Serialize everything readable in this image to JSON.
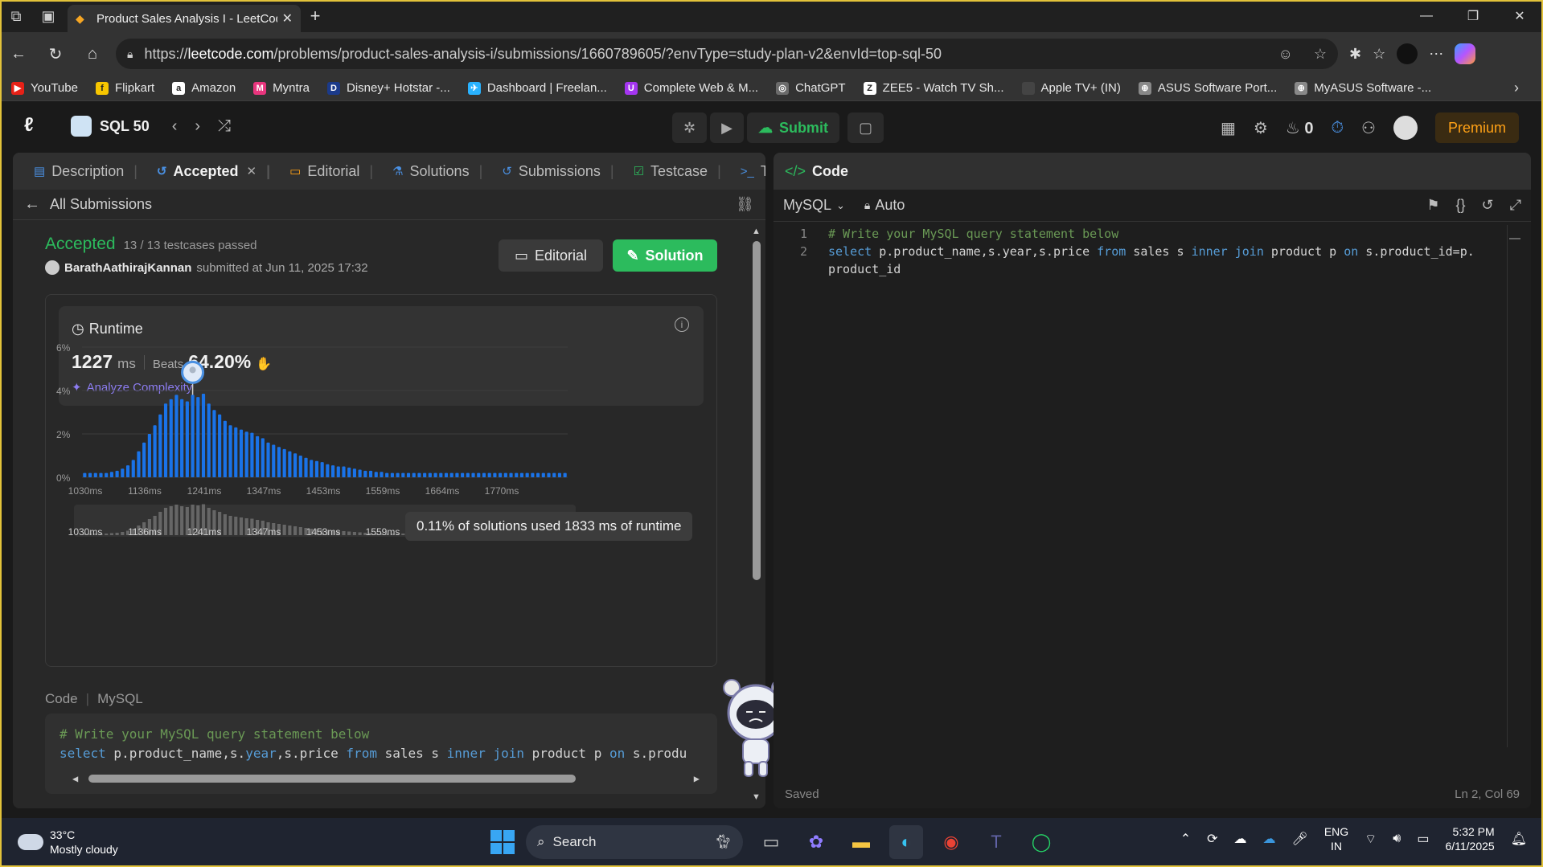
{
  "browser": {
    "tab_title": "Product Sales Analysis I - LeetCod",
    "url_prefix": "https://",
    "url_host": "leetcode.com",
    "url_path": "/problems/product-sales-analysis-i/submissions/1660789605/?envType=study-plan-v2&envId=top-sql-50",
    "bookmarks": [
      {
        "label": "YouTube",
        "color": "#e62117",
        "glyph": "▶"
      },
      {
        "label": "Flipkart",
        "color": "#f7c600",
        "glyph": "f"
      },
      {
        "label": "Amazon",
        "color": "#ffffff",
        "glyph": "a"
      },
      {
        "label": "Myntra",
        "color": "#e8357d",
        "glyph": "M"
      },
      {
        "label": "Disney+ Hotstar -...",
        "color": "#1b3a8a",
        "glyph": "D"
      },
      {
        "label": "Dashboard | Freelan...",
        "color": "#29b2fe",
        "glyph": "✈"
      },
      {
        "label": "Complete Web & M...",
        "color": "#a435f0",
        "glyph": "U"
      },
      {
        "label": "ChatGPT",
        "color": "#6b6b6b",
        "glyph": "◎"
      },
      {
        "label": "ZEE5 - Watch TV Sh...",
        "color": "#ffffff",
        "glyph": "Z"
      },
      {
        "label": "Apple TV+ (IN)",
        "color": "#444444",
        "glyph": ""
      },
      {
        "label": "ASUS Software Port...",
        "color": "#888888",
        "glyph": "⊕"
      },
      {
        "label": "MyASUS Software -...",
        "color": "#888888",
        "glyph": "⊕"
      }
    ]
  },
  "lcnav": {
    "study_plan": "SQL 50",
    "submit_label": "Submit",
    "streak_count": "0",
    "premium_label": "Premium"
  },
  "left": {
    "tabs": [
      {
        "label": "Description",
        "icon": "description-icon",
        "glyph": "▤"
      },
      {
        "label": "Accepted",
        "icon": "history-icon",
        "glyph": "↺"
      },
      {
        "label": "Editorial",
        "icon": "book-icon",
        "glyph": "▭"
      },
      {
        "label": "Solutions",
        "icon": "flask-icon",
        "glyph": "⚗"
      },
      {
        "label": "Submissions",
        "icon": "history-icon",
        "glyph": "↺"
      },
      {
        "label": "Testcase",
        "icon": "checkbox-icon",
        "glyph": "☑"
      },
      {
        "label": "Test Result",
        "icon": "terminal-icon",
        "glyph": ">_"
      }
    ],
    "all_submissions": "All Submissions",
    "status": "Accepted",
    "testcases": "13 / 13 testcases passed",
    "username": "BarathAathirajKannan",
    "submitted_at": "submitted at Jun 11, 2025 17:32",
    "editorial_btn": "Editorial",
    "solution_btn": "Solution",
    "runtime_label": "Runtime",
    "runtime_value": "1227",
    "runtime_unit": "ms",
    "beats_label": "Beats",
    "beats_value": "64.20%",
    "analyze_label": "Analyze Complexity",
    "tooltip": "0.11% of solutions used 1833 ms of runtime",
    "code_label": "Code",
    "code_lang": "MySQL",
    "code_comment": "# Write your MySQL query statement below",
    "code_tokens": [
      {
        "t": "select",
        "k": "kw"
      },
      {
        "t": " p.product_name,s.",
        "k": "txt"
      },
      {
        "t": "year",
        "k": "kw"
      },
      {
        "t": ",s.price ",
        "k": "txt"
      },
      {
        "t": "from",
        "k": "kw"
      },
      {
        "t": " sales s ",
        "k": "txt"
      },
      {
        "t": "inner",
        "k": "kw"
      },
      {
        "t": " ",
        "k": "txt"
      },
      {
        "t": "join",
        "k": "kw"
      },
      {
        "t": " product p ",
        "k": "txt"
      },
      {
        "t": "on",
        "k": "kw"
      },
      {
        "t": " s.produ",
        "k": "txt"
      }
    ]
  },
  "chart_data": {
    "type": "bar",
    "ylabel": "",
    "xlabel": "",
    "yticks": [
      "0%",
      "2%",
      "4%",
      "6%"
    ],
    "ylim": [
      0,
      6
    ],
    "xticks": [
      "1030ms",
      "1136ms",
      "1241ms",
      "1347ms",
      "1453ms",
      "1559ms",
      "1664ms",
      "1770ms"
    ],
    "highlight_index": 20,
    "values": [
      0.2,
      0.2,
      0.2,
      0.2,
      0.2,
      0.25,
      0.3,
      0.4,
      0.55,
      0.8,
      1.2,
      1.6,
      2.0,
      2.4,
      2.9,
      3.4,
      3.6,
      3.8,
      3.6,
      3.5,
      3.8,
      3.7,
      3.85,
      3.4,
      3.1,
      2.9,
      2.6,
      2.4,
      2.3,
      2.2,
      2.1,
      2.05,
      1.9,
      1.8,
      1.6,
      1.5,
      1.4,
      1.3,
      1.2,
      1.1,
      1.0,
      0.9,
      0.8,
      0.75,
      0.7,
      0.6,
      0.55,
      0.5,
      0.5,
      0.45,
      0.4,
      0.35,
      0.3,
      0.3,
      0.25,
      0.25,
      0.2,
      0.2,
      0.2,
      0.2,
      0.2,
      0.2,
      0.2,
      0.2,
      0.2,
      0.2,
      0.2,
      0.2,
      0.2,
      0.2,
      0.2,
      0.2,
      0.2,
      0.2,
      0.2,
      0.2,
      0.2,
      0.2,
      0.2,
      0.2,
      0.2,
      0.2,
      0.2,
      0.2,
      0.2,
      0.2,
      0.2,
      0.2,
      0.2,
      0.2
    ],
    "bar_color": "#1a73e8"
  },
  "right": {
    "title": "Code",
    "lang": "MySQL",
    "mode": "Auto",
    "lines": [
      {
        "num": "1",
        "tokens": [
          {
            "t": "# Write your MySQL query statement below",
            "k": "comment"
          }
        ]
      },
      {
        "num": "2",
        "tokens": [
          {
            "t": "select",
            "k": "kw"
          },
          {
            "t": " p.product_name,s.year,s.price ",
            "k": "txt"
          },
          {
            "t": "from",
            "k": "kw"
          },
          {
            "t": " sales s ",
            "k": "txt"
          },
          {
            "t": "inner",
            "k": "kw"
          },
          {
            "t": " ",
            "k": "txt"
          },
          {
            "t": "join",
            "k": "kw"
          },
          {
            "t": " product p ",
            "k": "txt"
          },
          {
            "t": "on",
            "k": "kw"
          },
          {
            "t": " s.product_id=p.",
            "k": "txt"
          }
        ]
      },
      {
        "num": "",
        "tokens": [
          {
            "t": "product_id",
            "k": "txt"
          }
        ]
      }
    ],
    "saved": "Saved",
    "cursor": "Ln 2, Col 69"
  },
  "taskbar": {
    "temp": "33°C",
    "weather": "Mostly cloudy",
    "search": "Search",
    "lang1": "ENG",
    "lang2": "IN",
    "time": "5:32 PM",
    "date": "6/11/2025"
  }
}
